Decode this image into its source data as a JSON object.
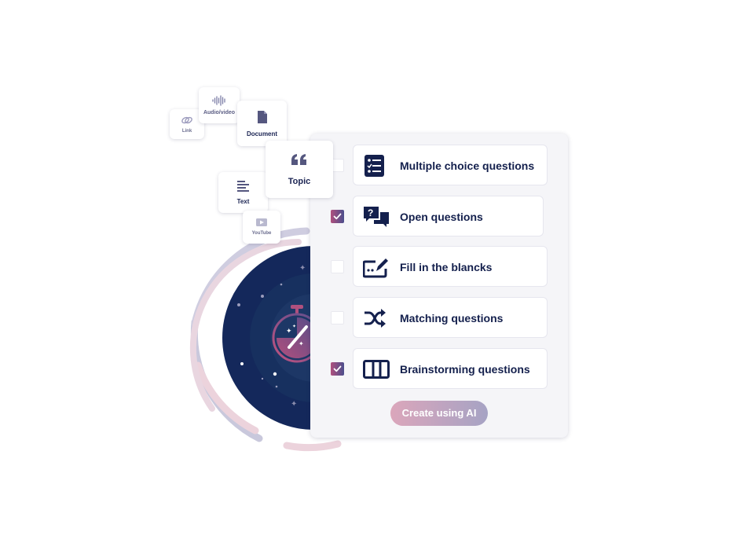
{
  "sources": {
    "link": {
      "label": "Link",
      "icon": "link-icon"
    },
    "audio_video": {
      "label": "Audio/video",
      "icon": "waveform-icon"
    },
    "document": {
      "label": "Document",
      "icon": "document-icon"
    },
    "topic": {
      "label": "Topic",
      "icon": "quote-icon"
    },
    "text": {
      "label": "Text",
      "icon": "text-lines-icon"
    },
    "youtube": {
      "label": "YouTube",
      "icon": "play-video-icon"
    }
  },
  "question_types": [
    {
      "label": "Multiple choice questions",
      "checked": false,
      "icon": "checklist-icon"
    },
    {
      "label": "Open questions",
      "checked": true,
      "icon": "speech-bubbles-question-icon"
    },
    {
      "label": "Fill in the blancks",
      "checked": false,
      "icon": "edit-field-icon"
    },
    {
      "label": "Matching questions",
      "checked": false,
      "icon": "shuffle-icon"
    },
    {
      "label": "Brainstorming questions",
      "checked": true,
      "icon": "columns-icon"
    }
  ],
  "create_button": {
    "label": "Create using AI"
  },
  "colors": {
    "navy": "#14204d",
    "accent_pink": "#b0507e",
    "accent_purple": "#4b4e8c",
    "panel_bg": "#f5f5f8"
  }
}
